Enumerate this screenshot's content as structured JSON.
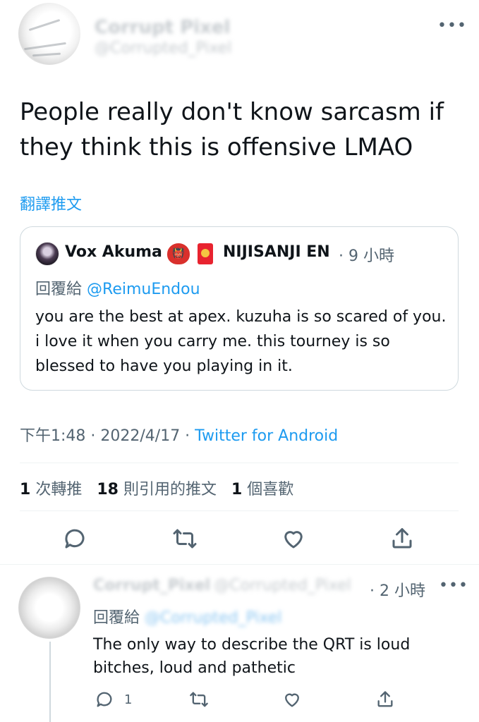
{
  "main_tweet": {
    "author_name": "Corrupt Pixel",
    "author_handle": "@Corrupted_Pixel",
    "more_label": "•••",
    "text": "People really don't know sarcasm if they think this is offensive LMAO",
    "translate_label": "翻譯推文",
    "quoted": {
      "name": "Vox Akuma",
      "org": "NIJISANJI EN",
      "time": "· 9 小時",
      "reply_prefix": "回覆給",
      "reply_handle": "@ReimuEndou",
      "text": "you are the best at apex. kuzuha is so scared of you. i love it when you carry me. this tourney is so blessed to have you playing in it."
    },
    "timestamp": "下午1:48 · 2022/4/17 · ",
    "source": "Twitter for Android",
    "stats": {
      "retweets_count": "1",
      "retweets_label": "次轉推",
      "quotes_count": "18",
      "quotes_label": "則引用的推文",
      "likes_count": "1",
      "likes_label": "個喜歡"
    }
  },
  "reply": {
    "author_name": "Corrupt_Pixel",
    "author_handle": "@Corrupted_Pixel",
    "time": "· 2 小時",
    "more_label": "•••",
    "reply_prefix": "回覆給",
    "reply_handle": "@Corrupted_Pixel",
    "text": "The only way to describe the QRT is loud bitches, loud and pathetic",
    "reply_count": "1"
  },
  "colors": {
    "accent": "#1d9bf0",
    "muted": "#536471",
    "border": "#cfd9de"
  }
}
